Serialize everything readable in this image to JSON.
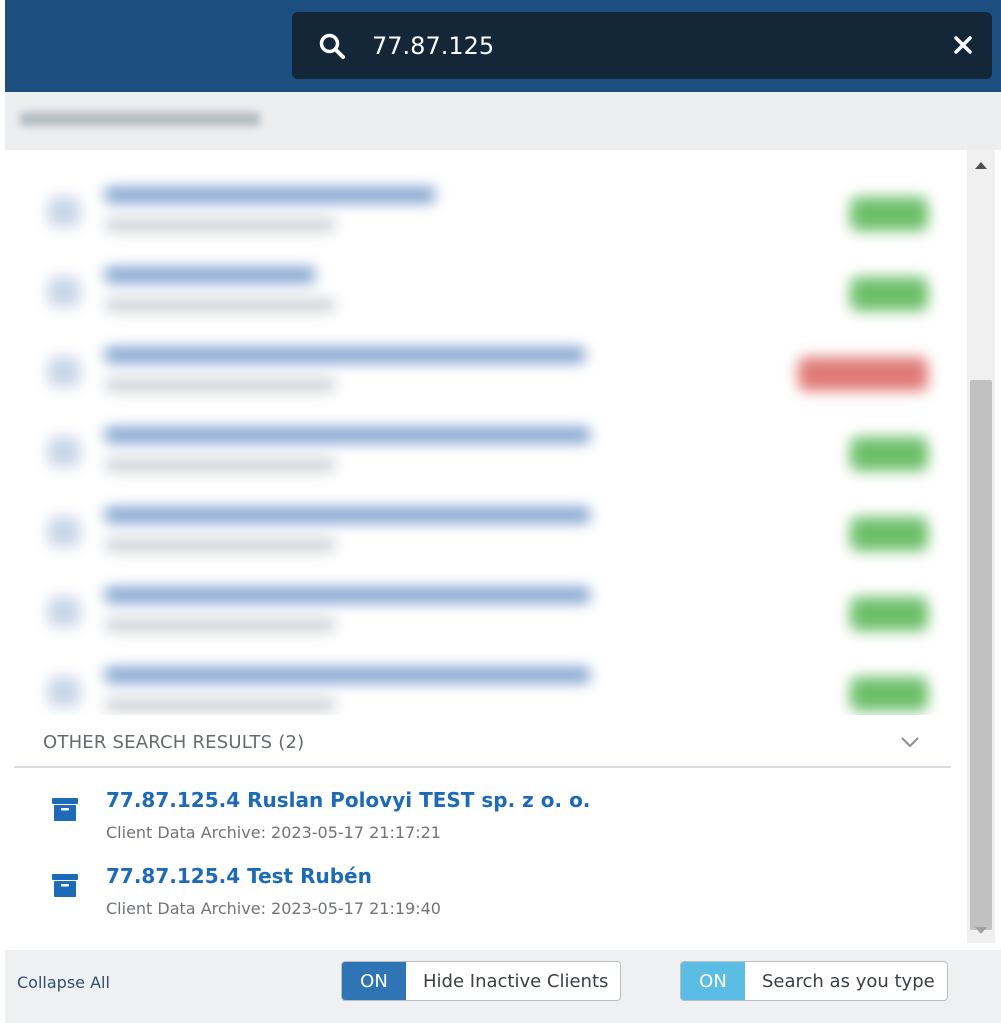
{
  "search": {
    "query": "77.87.125"
  },
  "other_results": {
    "title": "OTHER SEARCH RESULTS (2)",
    "items": [
      {
        "title": "77.87.125.4 Ruslan Polovyi TEST sp. z o. o.",
        "subtitle": "Client Data Archive: 2023-05-17 21:17:21"
      },
      {
        "title": "77.87.125.4 Test Rubén",
        "subtitle": "Client Data Archive: 2023-05-17 21:19:40"
      }
    ]
  },
  "footer": {
    "collapse_all": "Collapse All",
    "toggles": [
      {
        "state": "ON",
        "label": "Hide Inactive Clients",
        "color": "#2f74b5"
      },
      {
        "state": "ON",
        "label": "Search as you type",
        "color": "#5bbde3"
      }
    ]
  },
  "colors": {
    "header": "#1c4e80",
    "search_bg": "#142739",
    "link": "#1d6bb8",
    "status_green": "#6cbf6a",
    "status_red": "#e07b78"
  },
  "icons": {
    "search": "search-icon",
    "close": "close-icon",
    "archive": "archive-icon",
    "chevron": "chevron-down-icon"
  }
}
